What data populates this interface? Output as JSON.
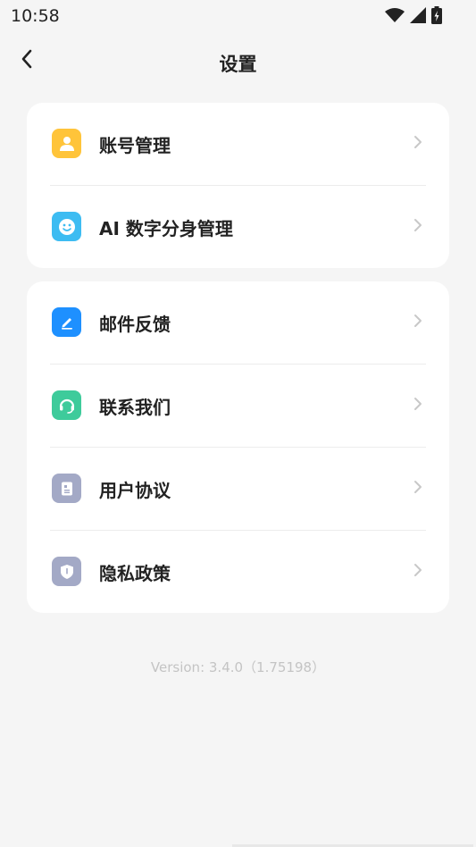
{
  "status_bar": {
    "time": "10:58",
    "icons": [
      "wifi-icon",
      "signal-icon",
      "battery-charging-icon"
    ]
  },
  "nav": {
    "title": "设置",
    "back_icon": "chevron-left-icon"
  },
  "sections": [
    {
      "items": [
        {
          "label": "账号管理",
          "icon": "user-icon",
          "color": "#FFC43A"
        },
        {
          "label": "AI 数字分身管理",
          "icon": "smiley-face-icon",
          "color": "#3DBCF2"
        }
      ]
    },
    {
      "items": [
        {
          "label": "邮件反馈",
          "icon": "edit-pen-icon",
          "color": "#1E90FF"
        },
        {
          "label": "联系我们",
          "icon": "headset-icon",
          "color": "#3ECB9B"
        },
        {
          "label": "用户协议",
          "icon": "document-icon",
          "color": "#A3A9C6"
        },
        {
          "label": "隐私政策",
          "icon": "shield-icon",
          "color": "#A3A9C6"
        }
      ]
    }
  ],
  "version_text": "Version: 3.4.0（1.75198）"
}
